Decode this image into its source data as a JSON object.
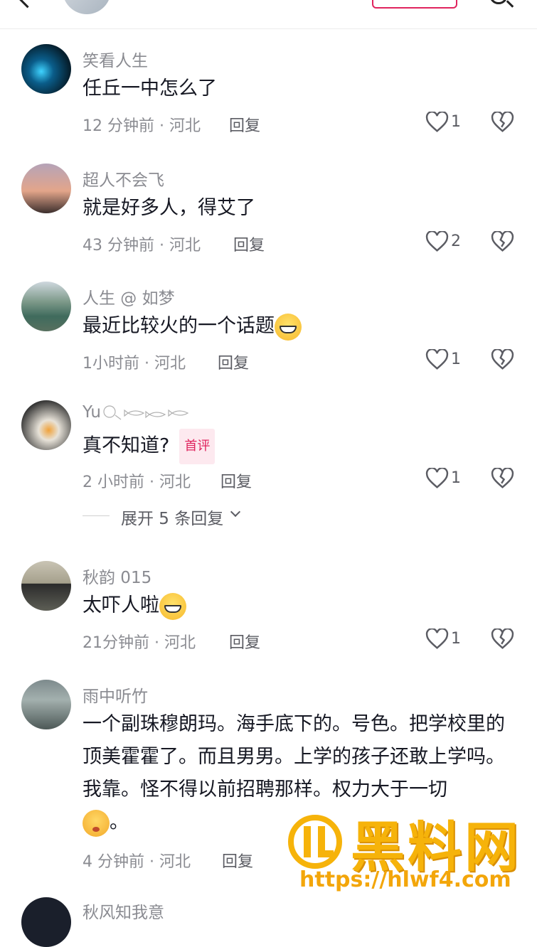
{
  "comments": [
    {
      "username": "笑看人生",
      "content": "任丘一中怎么了",
      "time": "12 分钟前 · 河北",
      "reply": "回复",
      "likes": "1"
    },
    {
      "username": "超人不会飞",
      "content": "就是好多人，得艾了",
      "time": "43 分钟前 · 河北",
      "reply": "回复",
      "likes": "2"
    },
    {
      "username": "人生 @ 如梦",
      "content": "最近比较火的一个话题",
      "time": "1小时前 · 河北",
      "reply": "回复",
      "likes": "1"
    },
    {
      "username": "Yu",
      "content": "真不知道?",
      "badge": "首评",
      "time": "2 小时前 · 河北",
      "reply": "回复",
      "likes": "1"
    },
    {
      "username": "秋韵 015",
      "content": "太吓人啦",
      "time": "21分钟前 · 河北",
      "reply": "回复",
      "likes": "1"
    },
    {
      "username": "雨中听竹",
      "content": "一个副珠穆朗玛。海手底下的。号色。把学校里的顶美霍霍了。而且男男。上学的孩子还敢上学吗。我靠。怪不得以前招聘那样。权力大于一切",
      "content_end": "。",
      "time": "4 分钟前 · 河北",
      "reply": "回复"
    },
    {
      "username": "秋风知我意"
    }
  ],
  "expand_replies": "展开 5 条回复",
  "watermark": {
    "text": "黑料网",
    "url": "https://hlwf4.com"
  }
}
